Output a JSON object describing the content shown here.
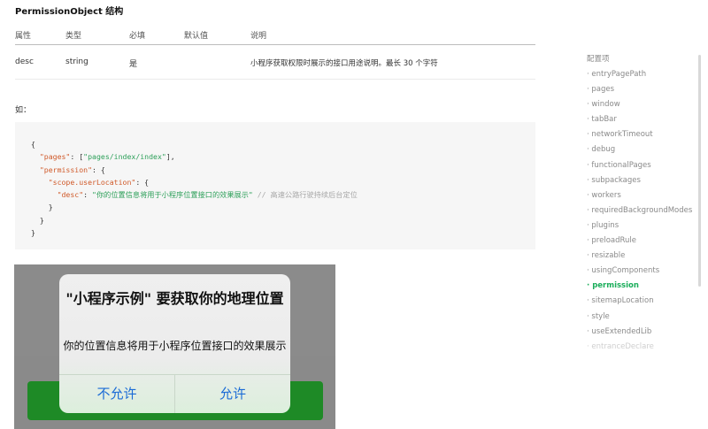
{
  "section": {
    "title": "PermissionObject 结构"
  },
  "table": {
    "headers": [
      "属性",
      "类型",
      "必填",
      "默认值",
      "说明"
    ],
    "rows": [
      [
        "desc",
        "string",
        "是",
        "",
        "小程序获取权限时展示的接口用途说明。最长 30 个字符"
      ]
    ]
  },
  "example": {
    "label": "如：",
    "code": {
      "l1": "{",
      "pages_key": "\"pages\"",
      "pages_mid": ": [",
      "pages_val": "\"pages/index/index\"",
      "pages_end": "],",
      "perm_key": "\"permission\"",
      "perm_mid": ": {",
      "scope_key": "\"scope.userLocation\"",
      "scope_mid": ": {",
      "desc_key": "\"desc\"",
      "desc_colon": ": ",
      "desc_val": "\"你的位置信息将用于小程序位置接口的效果展示\"",
      "desc_comment": " // 高速公路行驶持续后台定位",
      "close_scope": "}",
      "close_perm": "}",
      "close_root": "}"
    }
  },
  "dialog": {
    "title": "\"小程序示例\" 要获取你的地理位置",
    "message": "你的位置信息将用于小程序位置接口的效果展示",
    "deny_label": "不允许",
    "allow_label": "允许"
  },
  "toc": {
    "title": "配置项",
    "items": [
      "· entryPagePath",
      "· pages",
      "· window",
      "· tabBar",
      "· networkTimeout",
      "· debug",
      "· functionalPages",
      "· subpackages",
      "· workers",
      "· requiredBackgroundModes",
      "· plugins",
      "· preloadRule",
      "· resizable",
      "· usingComponents",
      "· permission",
      "· sitemapLocation",
      "· style",
      "· useExtendedLib",
      "· entranceDeclare"
    ],
    "active_index": 14
  },
  "colors": {
    "accent": "#1aad5a",
    "code_key": "#d05a2a",
    "code_string": "#2ea05a",
    "dialog_button": "#1a6bd6",
    "phone_button": "#1e8a26"
  }
}
